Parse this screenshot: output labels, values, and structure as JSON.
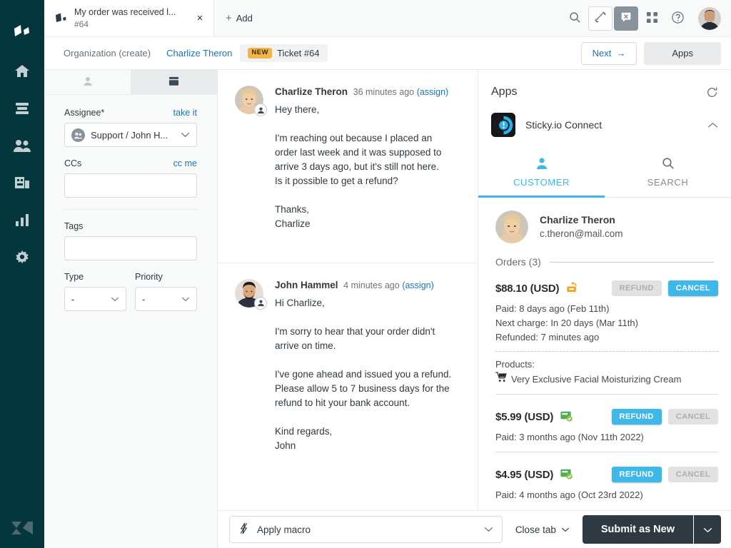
{
  "nav": {
    "items": [
      {
        "name": "zendesk-logo",
        "icon": "zendesk-logo-icon"
      },
      {
        "name": "home",
        "icon": "home-icon"
      },
      {
        "name": "views",
        "icon": "views-icon"
      },
      {
        "name": "customers",
        "icon": "customers-icon"
      },
      {
        "name": "organizations",
        "icon": "organizations-icon"
      },
      {
        "name": "reporting",
        "icon": "bar-chart-icon"
      },
      {
        "name": "admin",
        "icon": "gear-icon"
      }
    ],
    "footer_icon": "zendesk-mark-icon"
  },
  "tabbar": {
    "tab_title": "My order was received l...",
    "tab_subtitle": "#64",
    "close_label": "×",
    "add_label": "Add",
    "add_plus": "+",
    "icons": {
      "search": "search-icon",
      "call": "phone-icon",
      "chat_off": "chat-closed-icon",
      "grid": "apps-grid-icon",
      "help": "help-icon",
      "avatar": "user-avatar"
    }
  },
  "breadcrumb": {
    "items": [
      {
        "label": "Organization (create)",
        "style": "muted"
      },
      {
        "label": "Charlize Theron",
        "style": "link"
      },
      {
        "label": "Ticket #64",
        "style": "current",
        "badge": "NEW"
      }
    ],
    "next_label": "Next",
    "next_arrow": "→",
    "apps_label": "Apps"
  },
  "properties": {
    "tabs": [
      {
        "name": "user-tab",
        "icon": "person-icon",
        "active": false
      },
      {
        "name": "ticket-tab",
        "icon": "ticket-icon",
        "active": true
      }
    ],
    "assignee": {
      "label": "Assignee*",
      "action": "take it",
      "value": "Support / John H..."
    },
    "ccs": {
      "label": "CCs",
      "action": "cc me",
      "value": "",
      "placeholder": ""
    },
    "tags": {
      "label": "Tags",
      "value": "",
      "placeholder": ""
    },
    "type": {
      "label": "Type",
      "value": "-"
    },
    "priority": {
      "label": "Priority",
      "value": "-"
    }
  },
  "conversation": {
    "messages": [
      {
        "author": "Charlize Theron",
        "time": "36 minutes ago",
        "assign": "(assign)",
        "avatar": "charlize-avatar",
        "text": "Hey there,\n\nI'm reaching out because I placed an\norder last week and it was supposed to\narrive 3 days ago, but it's still not here.\nIs it possible to get a refund?\n\nThanks,\nCharlize"
      },
      {
        "author": "John Hammel",
        "time": "4 minutes ago",
        "assign": "(assign)",
        "avatar": "john-avatar",
        "text": "Hi Charlize,\n\nI'm sorry to hear that your order didn't\narrive on time.\n\nI've gone ahead and issued you a refund.\nPlease allow 5 to 7 business days for the\nrefund to hit your bank account.\n\nKind regards,\nJohn"
      }
    ]
  },
  "apps_panel": {
    "title": "Apps",
    "refresh_icon": "refresh-icon",
    "app": {
      "name": "Sticky.io Connect",
      "logo_icon": "stickyio-logo-icon",
      "collapse_icon": "chevron-up-icon"
    },
    "tabs": [
      {
        "label": "CUSTOMER",
        "icon": "person-icon",
        "active": true
      },
      {
        "label": "SEARCH",
        "icon": "search-icon",
        "active": false
      }
    ],
    "customer": {
      "name": "Charlize Theron",
      "email": "c.theron@mail.com",
      "avatar": "charlize-avatar"
    },
    "orders_label": "Orders (3)",
    "orders": [
      {
        "amount": "$88.10 (USD)",
        "status_icon": "refunded-box-icon",
        "status_color": "#f5a21f",
        "refund_label": "REFUND",
        "refund_enabled": false,
        "cancel_label": "CANCEL",
        "cancel_enabled": true,
        "lines": [
          "Paid: 8 days ago (Feb 11th)",
          "Next charge: In 20 days (Mar 11th)",
          "Refunded: 7 minutes ago"
        ],
        "products_label": "Products:",
        "products": [
          "Very Exclusive Facial Moisturizing Cream"
        ],
        "product_icon": "cart-icon"
      },
      {
        "amount": "$5.99 (USD)",
        "status_icon": "paid-card-icon",
        "status_color": "#4caf50",
        "refund_label": "REFUND",
        "refund_enabled": true,
        "cancel_label": "CANCEL",
        "cancel_enabled": false,
        "lines": [
          "Paid: 3 months ago (Nov 11th 2022)"
        ],
        "products_label": "",
        "products": [],
        "product_icon": ""
      },
      {
        "amount": "$4.95 (USD)",
        "status_icon": "paid-card-icon",
        "status_color": "#4caf50",
        "refund_label": "REFUND",
        "refund_enabled": true,
        "cancel_label": "CANCEL",
        "cancel_enabled": false,
        "lines": [
          "Paid: 4 months ago (Oct 23rd 2022)"
        ],
        "products_label": "",
        "products": [],
        "product_icon": ""
      }
    ]
  },
  "footer": {
    "macro_label": "Apply macro",
    "macro_icon": "lightning-icon",
    "close_tab_label": "Close tab",
    "submit_label": "Submit as New",
    "caret_icon": "chevron-down-icon"
  },
  "colors": {
    "nav_bg": "#03363d",
    "accent_blue": "#3db8e8",
    "link_blue": "#1f73b7",
    "badge_orange": "#f5b544",
    "submit_dark": "#2f3941",
    "paid_green": "#4caf50",
    "refund_orange": "#f5a21f"
  }
}
